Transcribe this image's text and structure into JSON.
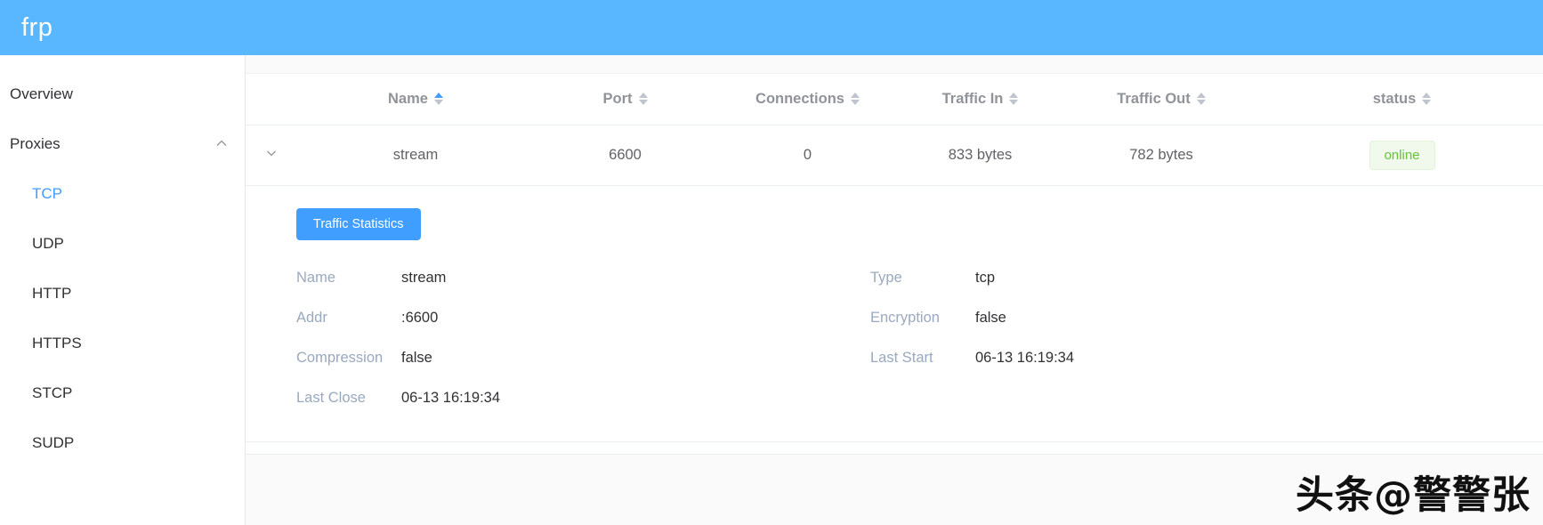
{
  "header": {
    "brand": "frp"
  },
  "sidebar": {
    "items": [
      {
        "label": "Overview",
        "sub": false,
        "active": false,
        "chevron": ""
      },
      {
        "label": "Proxies",
        "sub": false,
        "active": false,
        "chevron": "chevron-up-icon"
      },
      {
        "label": "TCP",
        "sub": true,
        "active": true,
        "chevron": ""
      },
      {
        "label": "UDP",
        "sub": true,
        "active": false,
        "chevron": ""
      },
      {
        "label": "HTTP",
        "sub": true,
        "active": false,
        "chevron": ""
      },
      {
        "label": "HTTPS",
        "sub": true,
        "active": false,
        "chevron": ""
      },
      {
        "label": "STCP",
        "sub": true,
        "active": false,
        "chevron": ""
      },
      {
        "label": "SUDP",
        "sub": true,
        "active": false,
        "chevron": ""
      }
    ]
  },
  "table": {
    "columns": [
      {
        "label": "Name",
        "sorted": "asc"
      },
      {
        "label": "Port",
        "sorted": "none"
      },
      {
        "label": "Connections",
        "sorted": "none"
      },
      {
        "label": "Traffic In",
        "sorted": "none"
      },
      {
        "label": "Traffic Out",
        "sorted": "none"
      },
      {
        "label": "status",
        "sorted": "none"
      }
    ],
    "rows": [
      {
        "expand_icon": "chevron-down-icon",
        "name": "stream",
        "port": "6600",
        "connections": "0",
        "traffic_in": "833 bytes",
        "traffic_out": "782 bytes",
        "status": "online"
      }
    ]
  },
  "detail": {
    "traffic_button": "Traffic Statistics",
    "left": [
      {
        "key": "Name",
        "value": "stream"
      },
      {
        "key": "Addr",
        "value": ":6600"
      },
      {
        "key": "Compression",
        "value": "false"
      },
      {
        "key": "Last Close",
        "value": "06-13 16:19:34"
      }
    ],
    "right": [
      {
        "key": "Type",
        "value": "tcp"
      },
      {
        "key": "Encryption",
        "value": "false"
      },
      {
        "key": "Last Start",
        "value": "06-13 16:19:34"
      },
      {
        "key": "",
        "value": ""
      }
    ]
  },
  "watermark": {
    "text": "头条@警警张"
  },
  "colors": {
    "header_blue": "#58b7ff",
    "accent_blue": "#409eff",
    "status_green_text": "#67c23a",
    "status_green_bg": "#f0f9eb"
  }
}
